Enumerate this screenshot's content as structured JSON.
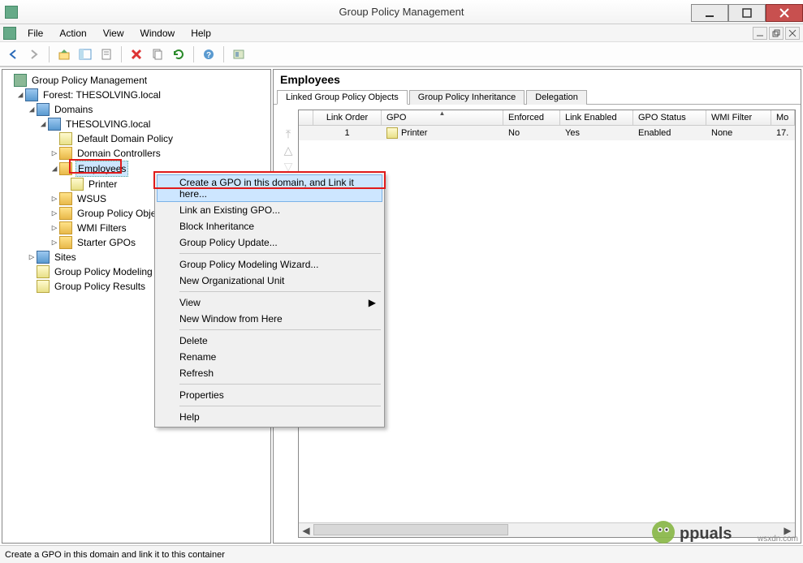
{
  "window": {
    "title": "Group Policy Management"
  },
  "menu": {
    "file": "File",
    "action": "Action",
    "view": "View",
    "window": "Window",
    "help": "Help"
  },
  "tree": {
    "root": "Group Policy Management",
    "forest": "Forest: THESOLVING.local",
    "domains": "Domains",
    "domain": "THESOLVING.local",
    "defaultPolicy": "Default Domain Policy",
    "domainControllers": "Domain Controllers",
    "employees": "Employees",
    "printer": "Printer",
    "wsus": "WSUS",
    "gpo": "Group Policy Objects",
    "wmi": "WMI Filters",
    "starter": "Starter GPOs",
    "sites": "Sites",
    "modeling": "Group Policy Modeling",
    "results": "Group Policy Results"
  },
  "detail": {
    "header": "Employees",
    "tabs": {
      "linked": "Linked Group Policy Objects",
      "inherit": "Group Policy Inheritance",
      "delegation": "Delegation"
    },
    "columns": {
      "order": "Link Order",
      "gpo": "GPO",
      "enforced": "Enforced",
      "linkEnabled": "Link Enabled",
      "gpoStatus": "GPO Status",
      "wmi": "WMI Filter",
      "modified": "Mo"
    },
    "row": {
      "order": "1",
      "gpo": "Printer",
      "enforced": "No",
      "linkEnabled": "Yes",
      "gpoStatus": "Enabled",
      "wmi": "None",
      "modified": "17."
    }
  },
  "context": {
    "createGpo": "Create a GPO in this domain, and Link it here...",
    "linkExisting": "Link an Existing GPO...",
    "blockInherit": "Block Inheritance",
    "gpUpdate": "Group Policy Update...",
    "modelingWiz": "Group Policy Modeling Wizard...",
    "newOu": "New Organizational Unit",
    "view": "View",
    "newWindow": "New Window from Here",
    "delete": "Delete",
    "rename": "Rename",
    "refresh": "Refresh",
    "properties": "Properties",
    "help": "Help"
  },
  "status": "Create a GPO in this domain and link it to this container",
  "watermark": "wsxdn.com"
}
